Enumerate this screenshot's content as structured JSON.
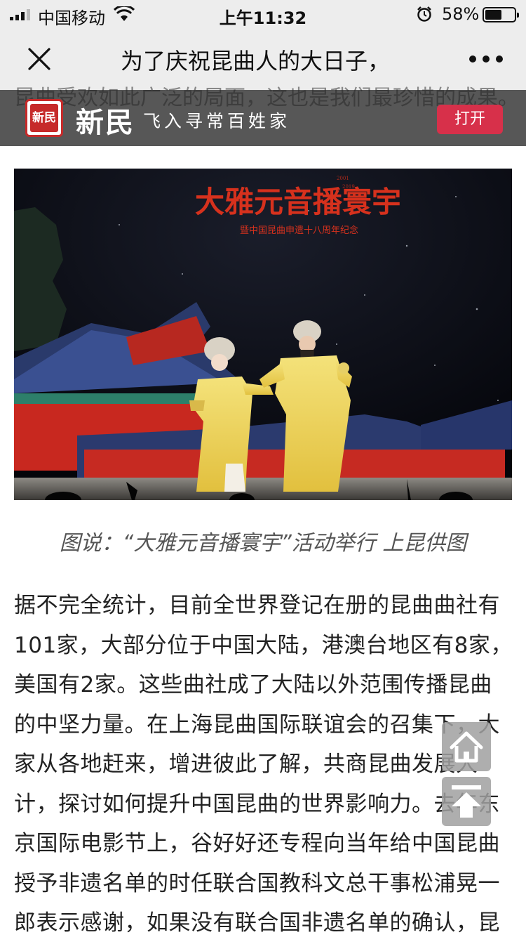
{
  "status_bar": {
    "carrier": "中国移动",
    "time": "上午11:32",
    "battery_percent": "58%",
    "battery_level": 0.58
  },
  "nav": {
    "title": "为了庆祝昆曲人的大日子，"
  },
  "banner_behind_text": "昆曲受欢如此广泛的局面，这也是我们最珍惜的成果。",
  "app_banner": {
    "logo_text": "新民",
    "name": "新民",
    "slogan": "飞入寻常百姓家",
    "open_label": "打开",
    "accent_color": "#d7304a"
  },
  "photo": {
    "headline": "大雅元音播寰宇",
    "subline": "暨中国昆曲申遗十八周年纪念",
    "years_top": "2001",
    "years_bottom": "2019"
  },
  "caption": "图说：“大雅元音播寰宇”活动举行 上昆供图",
  "article": {
    "paragraph": "据不完全统计，目前全世界登记在册的昆曲曲社有101家，大部分位于中国大陆，港澳台地区有8家，美国有2家。这些曲社成了大陆以外范围传播昆曲的中坚力量。在上海昆曲国际联谊会的召集下，大家从各地赶来，增进彼此了解，共商昆曲发展大计，探讨如何提升中国昆曲的世界影响力。去年东京国际电影节上，谷好好还专程向当年给中国昆曲授予非遗名单的时任联合国教科文总干事松浦晃一郎表示感谢，如果没有联合国非遗名单的确认，昆"
  },
  "float_buttons": {
    "home_icon": "home-icon",
    "top_icon": "arrow-up-icon"
  }
}
